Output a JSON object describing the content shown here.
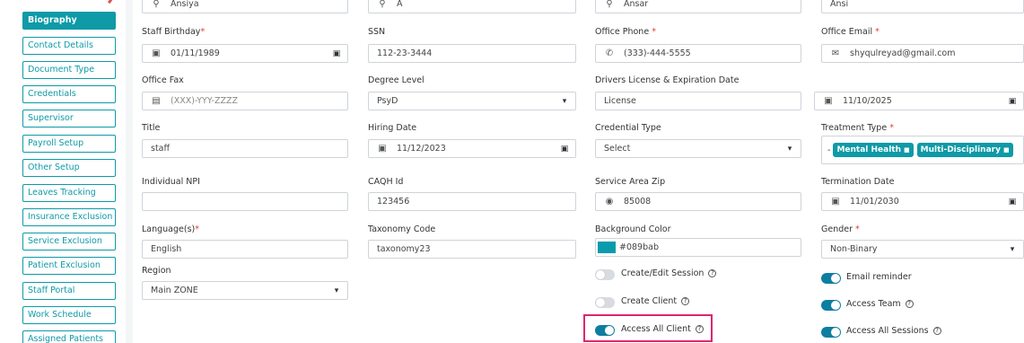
{
  "sidebar": {
    "items": [
      {
        "label": "Biography",
        "active": true
      },
      {
        "label": "Contact Details"
      },
      {
        "label": "Document Type"
      },
      {
        "label": "Credentials"
      },
      {
        "label": "Supervisor"
      },
      {
        "label": "Payroll Setup"
      },
      {
        "label": "Other Setup"
      },
      {
        "label": "Leaves Tracking"
      },
      {
        "label": "Insurance Exclusion"
      },
      {
        "label": "Service Exclusion"
      },
      {
        "label": "Patient Exclusion"
      },
      {
        "label": "Staff Portal"
      },
      {
        "label": "Work Schedule"
      },
      {
        "label": "Assigned Patients"
      }
    ]
  },
  "form": {
    "first_name": "Ansiya",
    "middle_name": "A",
    "last_name": "Ansar",
    "nick_name": "Ansi",
    "staff_birthday": {
      "label": "Staff Birthday",
      "value": "01/11/1989"
    },
    "ssn": {
      "label": "SSN",
      "value": "112-23-3444"
    },
    "office_phone": {
      "label": "Office Phone",
      "value": "(333)-444-5555"
    },
    "office_email": {
      "label": "Office Email",
      "value": "shyqulreyad@gmail.com"
    },
    "office_fax": {
      "label": "Office Fax",
      "placeholder": "(XXX)-YYY-ZZZZ"
    },
    "degree_level": {
      "label": "Degree Level",
      "value": "PsyD"
    },
    "drivers_license": {
      "label": "Drivers License & Expiration Date",
      "value": "License",
      "expiration": "11/10/2025"
    },
    "title": {
      "label": "Title",
      "value": "staff"
    },
    "hiring_date": {
      "label": "Hiring Date",
      "value": "11/12/2023"
    },
    "credential_type": {
      "label": "Credential Type",
      "value": "Select"
    },
    "treatment_type": {
      "label": "Treatment Type",
      "prefix": "-",
      "chips": [
        "Mental Health",
        "Multi-Disciplinary"
      ]
    },
    "individual_npi": {
      "label": "Individual NPI",
      "value": ""
    },
    "caqh_id": {
      "label": "CAQH Id",
      "value": "123456"
    },
    "service_area_zip": {
      "label": "Service Area Zip",
      "value": "85008"
    },
    "termination_date": {
      "label": "Termination Date",
      "value": "11/01/2030"
    },
    "languages": {
      "label": "Language(s)",
      "value": "English"
    },
    "taxonomy_code": {
      "label": "Taxonomy Code",
      "value": "taxonomy23"
    },
    "background_color": {
      "label": "Background Color",
      "value": "#089bab"
    },
    "gender": {
      "label": "Gender",
      "value": "Non-Binary"
    },
    "region": {
      "label": "Region",
      "value": "Main ZONE"
    }
  },
  "toggles": {
    "create_edit_session": {
      "label": "Create/Edit Session",
      "on": false
    },
    "create_client": {
      "label": "Create Client",
      "on": false
    },
    "access_all_client": {
      "label": "Access All Client",
      "on": true
    },
    "email_reminder": {
      "label": "Email reminder",
      "on": true
    },
    "access_team": {
      "label": "Access Team",
      "on": true
    },
    "access_all_sessions": {
      "label": "Access All Sessions",
      "on": true
    }
  },
  "glyphs": {
    "required": "*",
    "help": "?",
    "chip_remove": "■",
    "chevron": "▾",
    "calendar": "▣",
    "user": "⚲",
    "phone": "✆",
    "mail": "✉",
    "fax": "▤",
    "pin": "◉"
  },
  "colors": {
    "accent": "#0e9aa7",
    "toggle_on": "#0e7ea0",
    "highlight": "#e0246e",
    "required": "#e53935"
  }
}
